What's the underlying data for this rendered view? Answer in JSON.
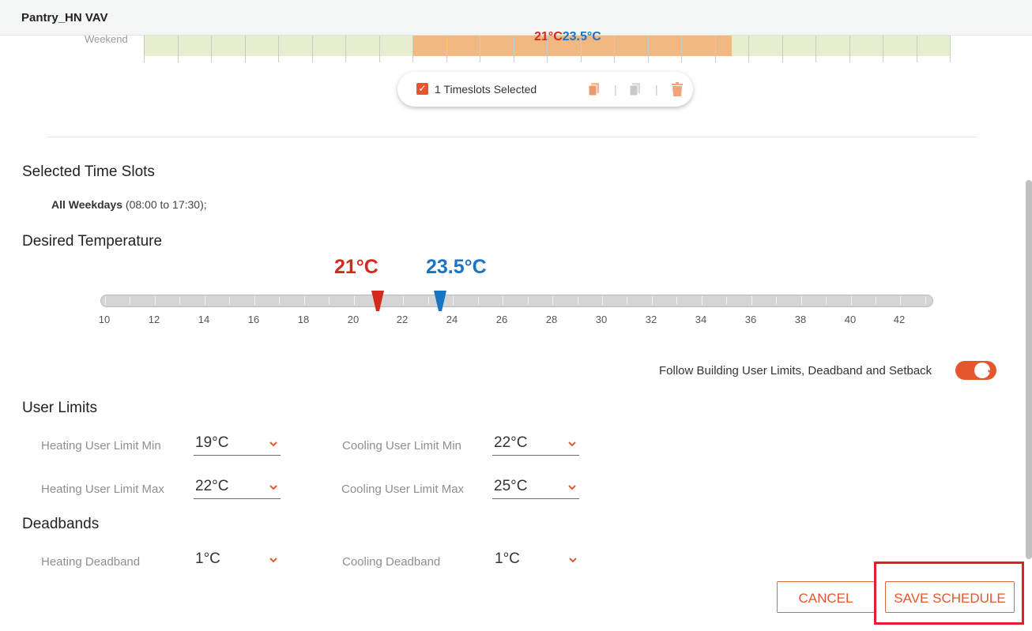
{
  "window": {
    "title": "Pantry_HN VAV"
  },
  "schedule_grid": {
    "row_label": "Weekend",
    "selected_heat_temp": "21°C",
    "selected_cool_temp": "23.5°C"
  },
  "selection_toolbar": {
    "selected_text": "1 Timeslots Selected",
    "icons": [
      "copy-icon",
      "paste-icon",
      "trash-icon"
    ]
  },
  "selected_slots": {
    "title": "Selected Time Slots",
    "day": "All Weekdays",
    "range": "(08:00 to 17:30);"
  },
  "desired_temperature": {
    "title": "Desired Temperature",
    "heat_label": "21°C",
    "cool_label": "23.5°C",
    "heat_value": 21,
    "cool_value": 23.5,
    "min": 10,
    "max": 43,
    "tick_labels": [
      "10",
      "12",
      "14",
      "16",
      "18",
      "20",
      "22",
      "24",
      "26",
      "28",
      "30",
      "32",
      "34",
      "36",
      "38",
      "40",
      "42"
    ],
    "colors": {
      "heat": "#d32a1e",
      "cool": "#1a74c4"
    }
  },
  "follow_building": {
    "label": "Follow Building User Limits, Deadband and Setback",
    "enabled": true
  },
  "user_limits": {
    "title": "User Limits",
    "heating_min": {
      "label": "Heating User Limit Min",
      "value": "19°C"
    },
    "heating_max": {
      "label": "Heating User Limit Max",
      "value": "22°C"
    },
    "cooling_min": {
      "label": "Cooling User Limit Min",
      "value": "22°C"
    },
    "cooling_max": {
      "label": "Cooling User Limit Max",
      "value": "25°C"
    }
  },
  "deadbands": {
    "title": "Deadbands",
    "heating": {
      "label": "Heating Deadband",
      "value": "1°C"
    },
    "cooling": {
      "label": "Cooling Deadband",
      "value": "1°C"
    }
  },
  "actions": {
    "cancel": "CANCEL",
    "save": "SAVE SCHEDULE"
  },
  "accent_color": "#e4572e"
}
